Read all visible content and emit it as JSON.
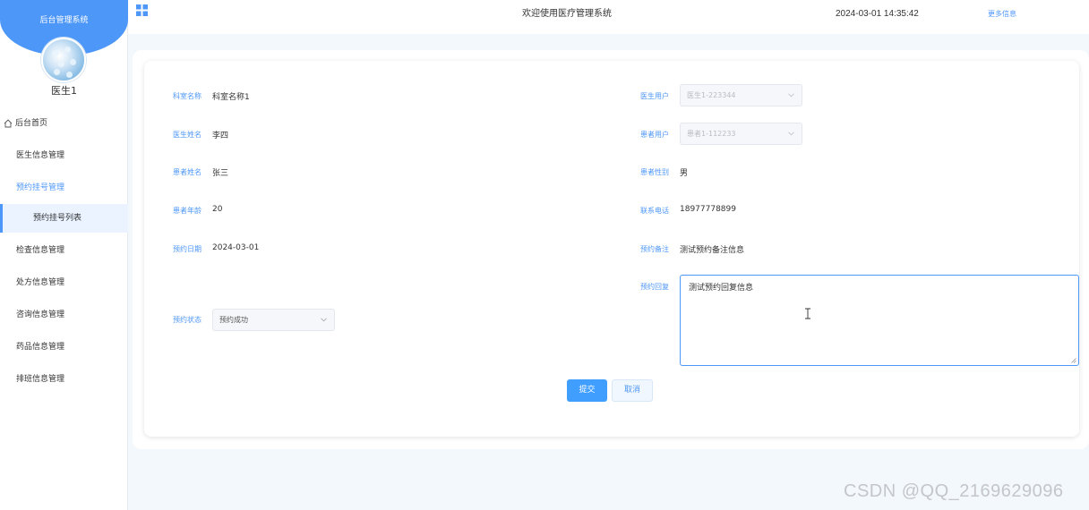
{
  "sidebar": {
    "system_title": "后台管理系统",
    "user_name": "医生1",
    "menu": {
      "home": "后台首页",
      "doctor": "医生信息管理",
      "appointment": "预约挂号管理",
      "appointment_list": "预约挂号列表",
      "checkup": "检查信息管理",
      "prescription": "处方信息管理",
      "consult": "咨询信息管理",
      "drug": "药品信息管理",
      "schedule": "排班信息管理"
    }
  },
  "header": {
    "title": "欢迎使用医疗管理系统",
    "datetime": "2024-03-01 14:35:42",
    "more": "更多信息"
  },
  "form": {
    "dept_label": "科室名称",
    "dept_value": "科室名称1",
    "doctor_user_label": "医生用户",
    "doctor_user_value": "医生1-223344",
    "doctor_name_label": "医生姓名",
    "doctor_name_value": "李四",
    "patient_user_label": "患者用户",
    "patient_user_value": "患者1-112233",
    "patient_name_label": "患者姓名",
    "patient_name_value": "张三",
    "gender_label": "患者性别",
    "gender_value": "男",
    "age_label": "患者年龄",
    "age_value": "20",
    "phone_label": "联系电话",
    "phone_value": "18977778899",
    "date_label": "预约日期",
    "date_value": "2024-03-01",
    "remark_label": "预约备注",
    "remark_value": "测试预约备注信息",
    "reply_label": "预约回复",
    "reply_value": "测试预约回复信息",
    "status_label": "预约状态",
    "status_value": "预约成功",
    "submit_label": "提交",
    "cancel_label": "取消"
  },
  "watermark": "CSDN @QQ_2169629096",
  "colors": {
    "accent": "#4d97f8",
    "button_primary": "#409eff",
    "background": "#f3f8fd"
  }
}
